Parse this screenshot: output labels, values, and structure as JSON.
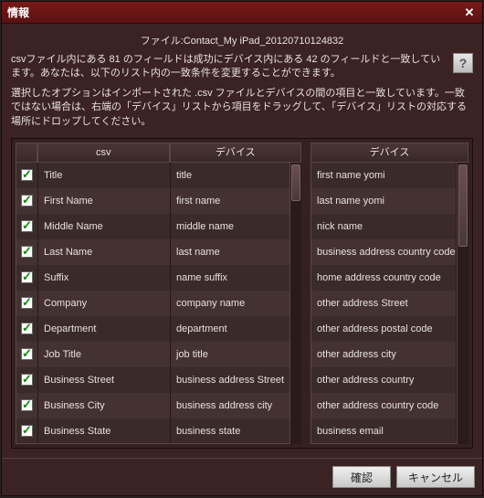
{
  "window": {
    "title": "情報"
  },
  "info": {
    "file_line": "ファイル:Contact_My iPad_20120710124832",
    "match_line": "csvファイル内にある 81 のフィールドは成功にデバイス内にある 42 のフィールドと一致しています。あなたは、以下のリスト内の一致条件を変更することができます。",
    "option_line": "選択したオプションはインポートされた .csv ファイルとデバイスの間の項目と一致しています。一致ではない場合は、右端の「デバイス」リストから項目をドラッグして、「デバイス」リストの対応する場所にドロップしてください。"
  },
  "headers": {
    "csv": "csv",
    "device": "デバイス",
    "device_right": "デバイス"
  },
  "left_rows": [
    {
      "checked": true,
      "csv": "Title",
      "device": "title"
    },
    {
      "checked": true,
      "csv": "First Name",
      "device": "first name"
    },
    {
      "checked": true,
      "csv": "Middle Name",
      "device": "middle name"
    },
    {
      "checked": true,
      "csv": "Last Name",
      "device": "last name"
    },
    {
      "checked": true,
      "csv": "Suffix",
      "device": "name suffix"
    },
    {
      "checked": true,
      "csv": "Company",
      "device": "company name"
    },
    {
      "checked": true,
      "csv": "Department",
      "device": "department"
    },
    {
      "checked": true,
      "csv": "Job Title",
      "device": "job title"
    },
    {
      "checked": true,
      "csv": "Business Street",
      "device": "business address Street"
    },
    {
      "checked": true,
      "csv": "Business City",
      "device": "business address city"
    },
    {
      "checked": true,
      "csv": "Business State",
      "device": "business state"
    }
  ],
  "right_rows": [
    "first name yomi",
    "last name yomi",
    "nick name",
    "business address country code",
    "home address country code",
    "other address Street",
    "other address postal code",
    "other address city",
    "other address country",
    "other address country code",
    "business email"
  ],
  "buttons": {
    "ok": "確認",
    "cancel": "キャンセル",
    "help": "?"
  }
}
